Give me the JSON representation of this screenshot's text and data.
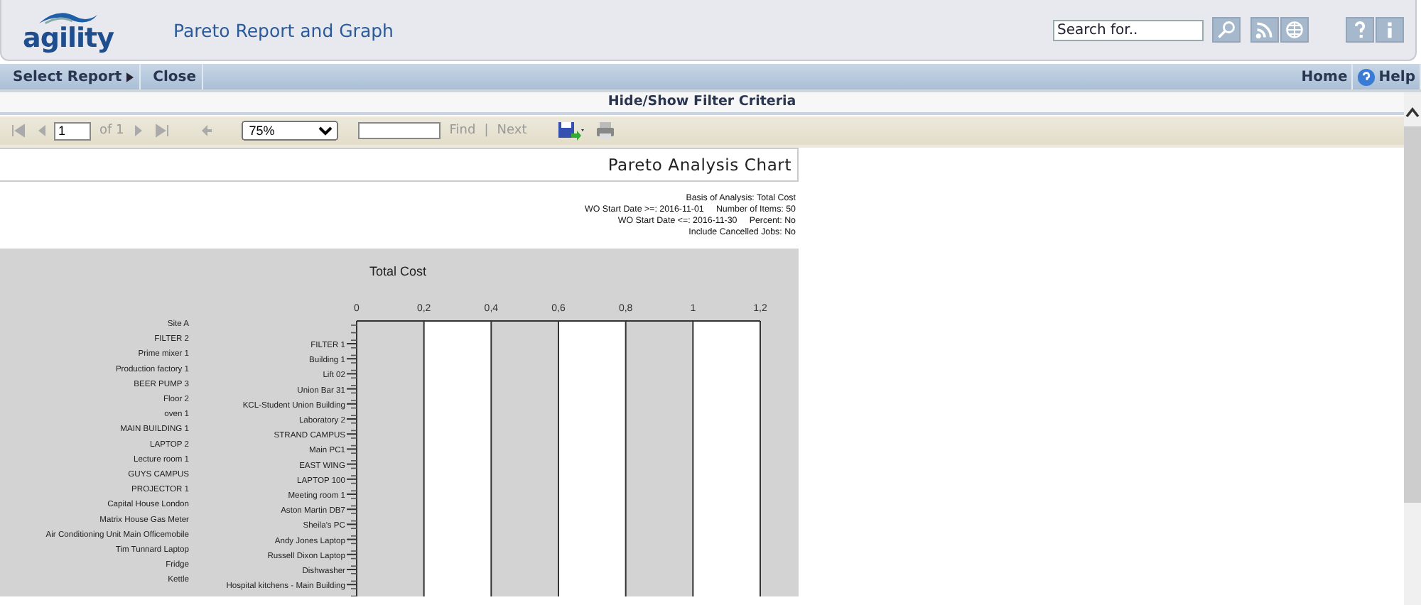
{
  "header": {
    "logo": "agility",
    "title": "Pareto Report and Graph",
    "search": {
      "placeholder": "Search for.."
    }
  },
  "menu": {
    "left": [
      {
        "label": "Select Report",
        "kind": "submenu"
      },
      {
        "label": "Close",
        "kind": "plain"
      }
    ],
    "right": [
      {
        "label": "Home",
        "kind": "plain"
      },
      {
        "label": "Help",
        "kind": "help"
      }
    ]
  },
  "filter_toggle": "Hide/Show Filter Criteria",
  "toolbar": {
    "page": "1",
    "of": "of 1",
    "zoom": "75%",
    "find": "Find",
    "separator": "|",
    "next": "Next"
  },
  "report": {
    "title": "Pareto Analysis Chart",
    "criteria": [
      "Basis of Analysis: Total Cost",
      "WO Start Date >=: 2016-11-01     Number of Items: 50",
      "WO Start Date <=: 2016-11-30     Percent: No",
      "Include Cancelled Jobs: No"
    ],
    "left_labels": [
      "Site A",
      "FILTER 2",
      "Prime mixer 1",
      "Production factory 1",
      "BEER PUMP 3",
      "Floor 2",
      "oven 1",
      "MAIN BUILDING 1",
      "LAPTOP 2",
      "Lecture room 1",
      "GUYS CAMPUS",
      "PROJECTOR 1",
      "Capital House London",
      "Matrix House Gas Meter",
      "Air Conditioning Unit Main Officemobile",
      "Tim Tunnard Laptop",
      "Fridge",
      "Kettle"
    ],
    "chart_data": {
      "type": "bar",
      "orientation": "horizontal",
      "title": "Total Cost",
      "categories": [
        "FILTER 1",
        "Building 1",
        "Lift 02",
        "Union Bar 31",
        "KCL-Student Union Building",
        "Laboratory 2",
        "STRAND CAMPUS",
        "Main  PC1",
        "EAST WING",
        "LAPTOP 100",
        "Meeting room 1",
        "Aston Martin DB7",
        "Sheila's PC",
        "Andy Jones Laptop",
        "Russell Dixon Laptop",
        "Dishwasher",
        "Hospital kitchens - Main Building"
      ],
      "values": [
        0,
        0,
        0,
        0,
        0,
        0,
        0,
        0,
        0,
        0,
        0,
        0,
        0,
        0,
        0,
        0,
        0
      ],
      "grid": true,
      "xlim": [
        0,
        1.2
      ],
      "xticks": [
        0,
        {
          "value": 0.2,
          "label": "0,2"
        },
        {
          "value": 0.4,
          "label": "0,4"
        },
        {
          "value": 0.6,
          "label": "0,6"
        },
        {
          "value": 0.8,
          "label": "0,8"
        },
        1,
        {
          "value": 1.2,
          "label": "1,2"
        }
      ]
    }
  }
}
